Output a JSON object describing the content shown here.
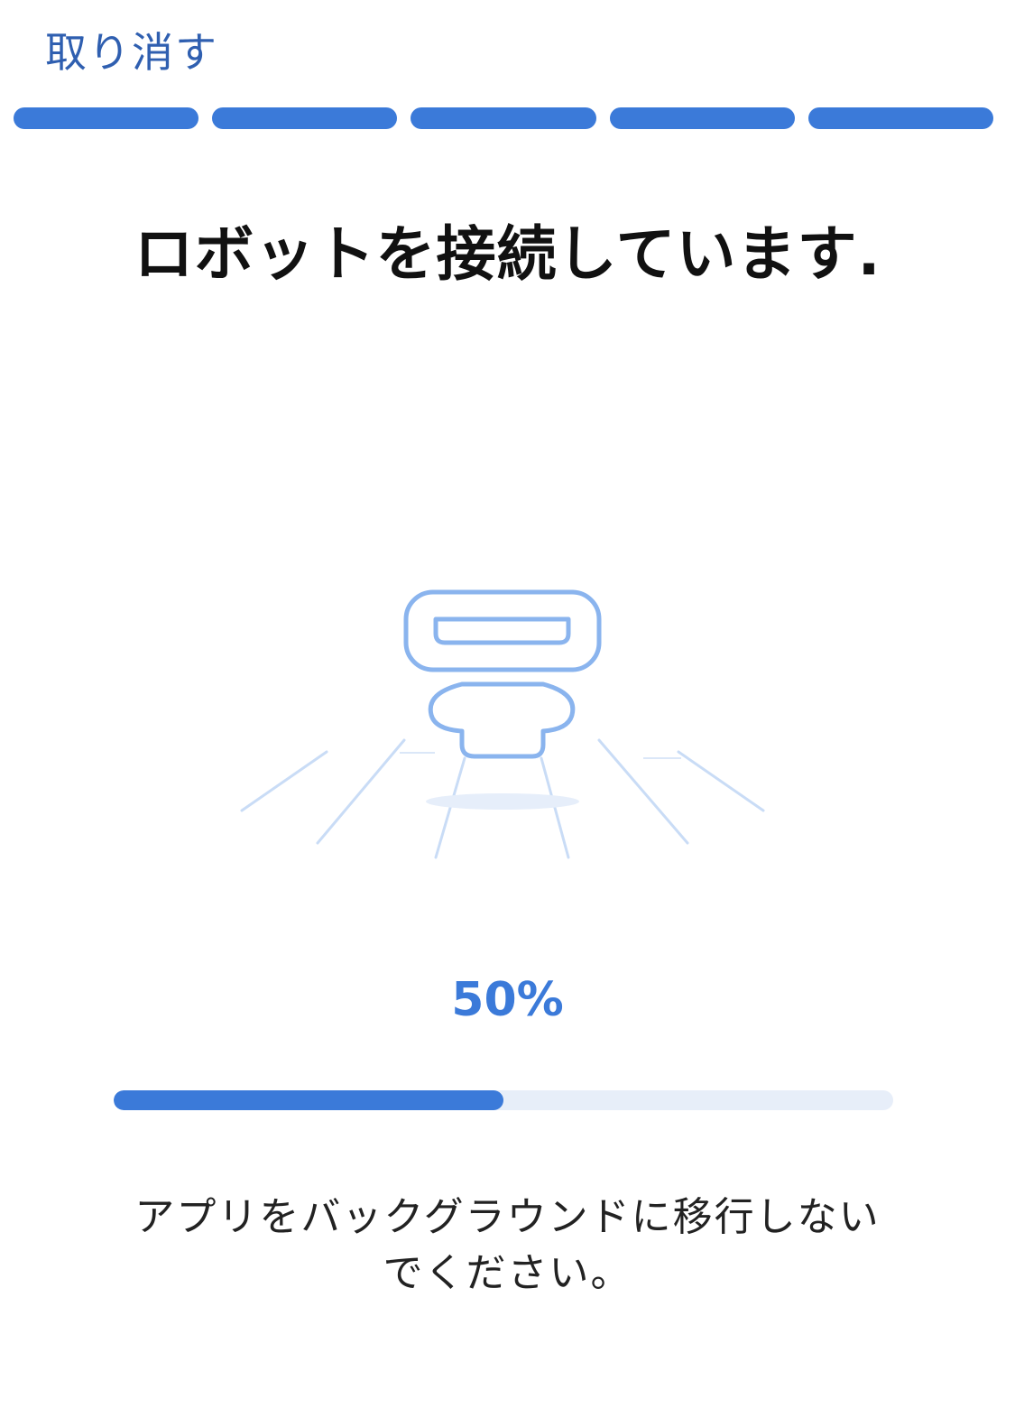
{
  "header": {
    "cancel_label": "取り消す"
  },
  "steps": {
    "total": 5,
    "completed": 5,
    "active_color": "#3b7ad9"
  },
  "main": {
    "title": "ロボットを接続しています.",
    "illustration_icon": "robot-connecting-icon"
  },
  "progress": {
    "percent_label": "50%",
    "value": 0.5,
    "fill_color": "#3b7ad9",
    "track_color": "#e7eef9"
  },
  "notice": {
    "line1": "アプリをバックグラウンドに移行しない",
    "line2": "でください。"
  }
}
